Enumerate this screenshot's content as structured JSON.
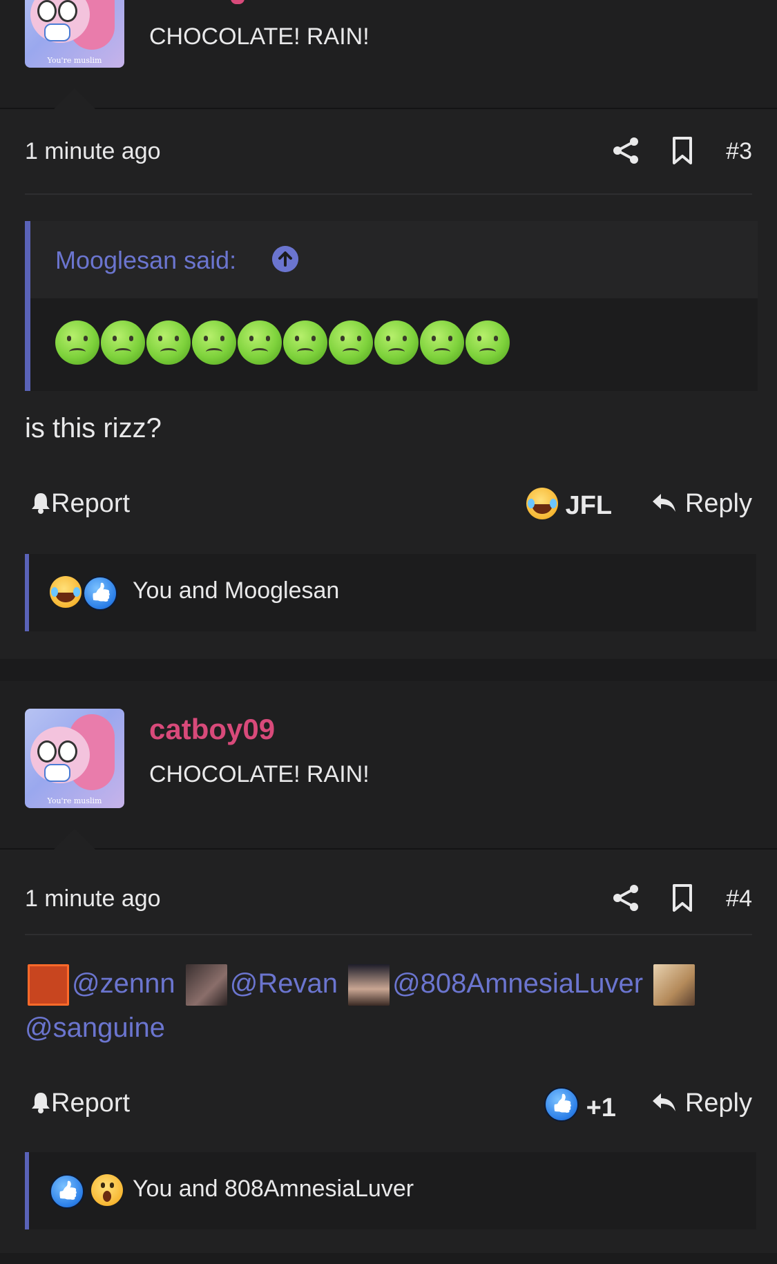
{
  "colors": {
    "background": "#1b1b1c",
    "post_bg": "#212122",
    "accent_blue": "#6b75cf",
    "author_pink": "#d84a7a",
    "text": "#e9e9ea"
  },
  "posts": [
    {
      "author_title": "CHOCOLATE! RAIN!",
      "avatar_caption": "You're muslim",
      "time": "1 minute ago",
      "number": "#3",
      "quote": {
        "author": "Mooglesan said:",
        "emoji": "nauseous-face",
        "emoji_count": 10
      },
      "body": "is this rizz?",
      "actions": {
        "report": "Report",
        "reaction": "JFL",
        "reaction_icon": "laughing-crying-face-icon",
        "reply": "Reply"
      },
      "reactions_summary": "You and Mooglesan"
    },
    {
      "author_name": "catboy09",
      "author_title": "CHOCOLATE! RAIN!",
      "avatar_caption": "You're muslim",
      "time": "1 minute ago",
      "number": "#4",
      "mentions": [
        "@zennn",
        "@Revan",
        "@808AmnesiaLuver",
        "@sanguine"
      ],
      "actions": {
        "report": "Report",
        "reaction": "+1",
        "reaction_icon": "thumbs-up-icon",
        "reply": "Reply"
      },
      "reactions_summary": "You and 808AmnesiaLuver"
    }
  ]
}
